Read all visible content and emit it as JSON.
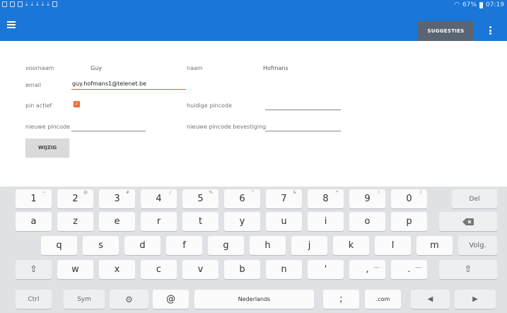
{
  "status": {
    "battery": "67%",
    "time": "07:19"
  },
  "appbar": {
    "suggest_label": "SUGGESTIES"
  },
  "form": {
    "voornaam_label": "voornaam",
    "voornaam_value": "Guy",
    "naam_label": "naam",
    "naam_value": "Hofmans",
    "email_label": "email",
    "email_value": "guy.hofmans1@telenet.be",
    "pin_actief_label": "pin actief",
    "pin_actief_checked": true,
    "huidige_label": "huidige pincode",
    "nieuwe_label": "nieuwe pincode",
    "bevestiging_label": "nieuwe pincode bevestiging",
    "wijzig_label": "WIJZIG"
  },
  "keyboard": {
    "row1": [
      {
        "key": "1",
        "sup": "~"
      },
      {
        "key": "2",
        "sup": "@"
      },
      {
        "key": "3",
        "sup": "#"
      },
      {
        "key": "4",
        "sup": "/"
      },
      {
        "key": "5",
        "sup": "%"
      },
      {
        "key": "6",
        "sup": "^"
      },
      {
        "key": "7",
        "sup": "&"
      },
      {
        "key": "8",
        "sup": "*"
      },
      {
        "key": "9",
        "sup": "("
      },
      {
        "key": "0",
        "sup": ")"
      }
    ],
    "del": "Del",
    "row2": [
      "a",
      "z",
      "e",
      "r",
      "t",
      "y",
      "u",
      "i",
      "o",
      "p"
    ],
    "row3": [
      "q",
      "s",
      "d",
      "f",
      "g",
      "h",
      "j",
      "k",
      "l",
      "m"
    ],
    "volg": "Volg.",
    "row4": [
      "w",
      "x",
      "c",
      "v",
      "b",
      "n"
    ],
    "row4_punct": [
      {
        "key": "'",
        "sup": ""
      },
      {
        "key": ",",
        "sup": "—"
      },
      {
        "key": ".",
        "sup": "—"
      }
    ],
    "ctrl": "Ctrl",
    "sym": "Sym",
    "at": "@",
    "space": "Nederlands",
    "semicolon": ";",
    "dotcom": ".com"
  }
}
